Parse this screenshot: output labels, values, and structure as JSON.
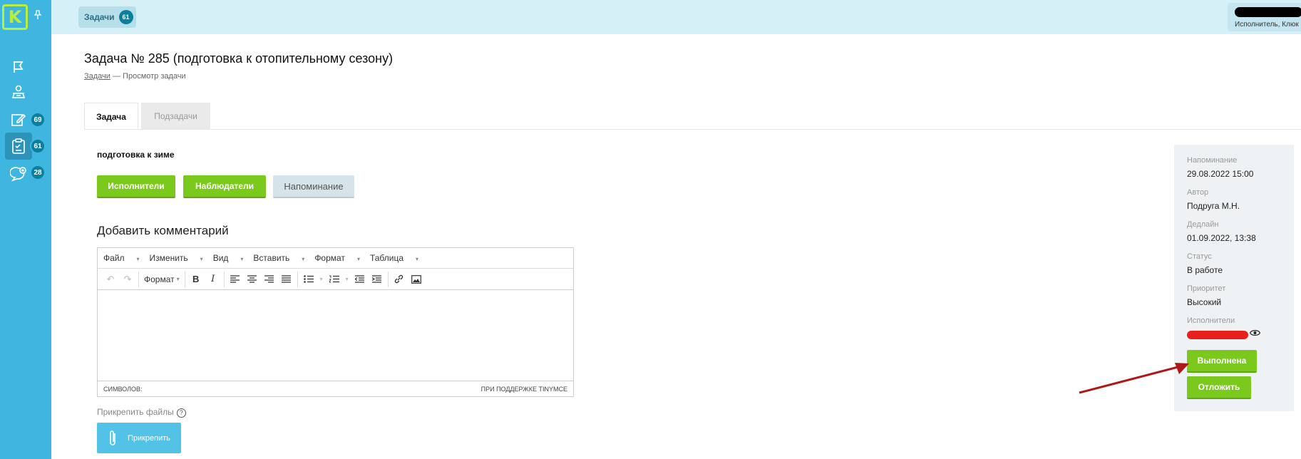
{
  "sidebar": {
    "logo": "K",
    "items": [
      {
        "name": "flag-icon",
        "badge": null
      },
      {
        "name": "people-icon",
        "badge": null
      },
      {
        "name": "edit-icon",
        "badge": "69"
      },
      {
        "name": "clipboard-icon",
        "badge": "61",
        "active": true
      },
      {
        "name": "chat-icon",
        "badge": "28"
      }
    ]
  },
  "topbar": {
    "tab_label": "Задачи",
    "tab_count": "61",
    "user_role": "Исполнитель, Клюк"
  },
  "page": {
    "title": "Задача № 285 (подготовка к отопительному сезону)",
    "breadcrumb_link": "Задачи",
    "breadcrumb_current": "— Просмотр задачи"
  },
  "tabs": {
    "task": "Задача",
    "subtasks": "Подзадачи"
  },
  "task": {
    "description": "подготовка к зиме",
    "btn_executors": "Исполнители",
    "btn_observers": "Наблюдатели",
    "btn_reminder": "Напоминание"
  },
  "comment": {
    "heading": "Добавить комментарий",
    "menu": [
      "Файл",
      "Изменить",
      "Вид",
      "Вставить",
      "Формат",
      "Таблица"
    ],
    "format_label": "Формат",
    "chars_label": "СИМВОЛОВ:",
    "powered": "ПРИ ПОДДЕРЖКЕ TINYMCE"
  },
  "attach": {
    "label": "Прикрепить файлы",
    "button": "Прикрепить"
  },
  "info": {
    "reminder_label": "Напоминание",
    "reminder_value": "29.08.2022 15:00",
    "author_label": "Автор",
    "author_value": "Подруга М.Н.",
    "deadline_label": "Дедлайн",
    "deadline_value": "01.09.2022, 13:38",
    "status_label": "Статус",
    "status_value": "В работе",
    "priority_label": "Приоритет",
    "priority_value": "Высокий",
    "executors_label": "Исполнители",
    "done_button": "Выполнена",
    "postpone_button": "Отложить"
  },
  "colors": {
    "sidebar": "#3fb6e0",
    "accent_green": "#7cc91d",
    "badge": "#0b7f9e",
    "arrow": "#b01818"
  }
}
